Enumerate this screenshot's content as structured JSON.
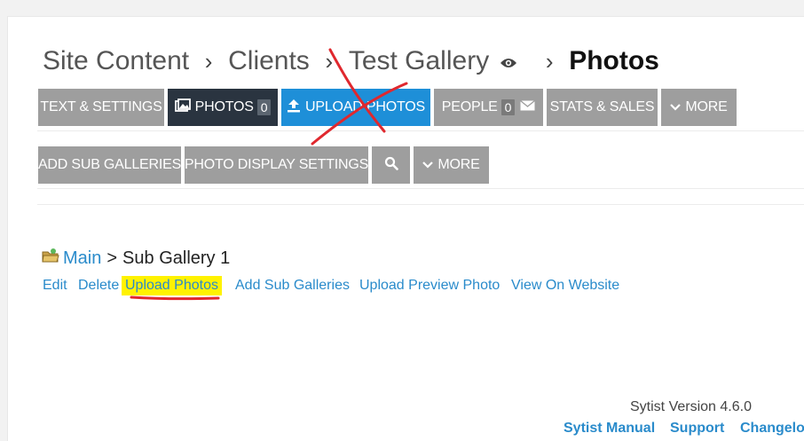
{
  "breadcrumb": {
    "items": [
      "Site Content",
      "Clients",
      "Test Gallery",
      "Photos"
    ],
    "separator": "›"
  },
  "tabs": {
    "text_settings": "TEXT & SETTINGS",
    "photos": "PHOTOS",
    "photos_count": "0",
    "upload_photos": "UPLOAD PHOTOS",
    "people": "PEOPLE",
    "people_count": "0",
    "stats_sales": "STATS & SALES",
    "more": "MORE"
  },
  "subtoolbar": {
    "add_sub_galleries": "ADD SUB GALLERIES",
    "photo_display_settings": "PHOTO DISPLAY SETTINGS",
    "more": "MORE"
  },
  "sub_gallery": {
    "main_link": "Main",
    "current": "Sub Gallery 1",
    "gt": ">"
  },
  "actions": {
    "edit": "Edit",
    "delete": "Delete",
    "upload_photos": "Upload Photos",
    "add_sub_galleries": "Add Sub Galleries",
    "upload_preview_photo": "Upload Preview Photo",
    "view_on_website": "View On Website"
  },
  "footer": {
    "version": "Sytist Version 4.6.0",
    "manual": "Sytist Manual",
    "support": "Support",
    "changelog": "Changelog"
  },
  "colors": {
    "button_gray": "#9e9e9e",
    "button_dark": "#2a3440",
    "button_blue": "#1e8fd8",
    "link_blue": "#2a8bcb",
    "highlight_yellow": "#fff200",
    "annotation_red": "#e0282e"
  }
}
